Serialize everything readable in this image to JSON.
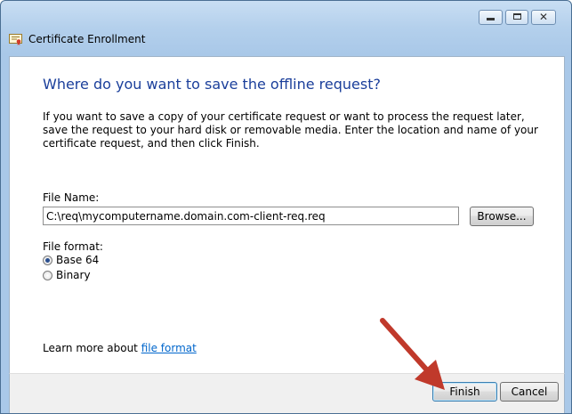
{
  "window": {
    "title": "Certificate Enrollment",
    "controls": {
      "minimize": "minimize",
      "maximize": "maximize",
      "close": "close"
    }
  },
  "page": {
    "heading": "Where do you want to save the offline request?",
    "description": "If you want to save a copy of your certificate request or want to process the request later, save the request to your hard disk or removable media. Enter the location and name of your certificate request, and then click Finish."
  },
  "file_name": {
    "label": "File Name:",
    "value": "C:\\req\\mycomputername.domain.com-client-req.req",
    "browse_label": "Browse..."
  },
  "file_format": {
    "label": "File format:",
    "options": [
      {
        "label": "Base 64",
        "selected": true
      },
      {
        "label": "Binary",
        "selected": false
      }
    ]
  },
  "learn_more": {
    "text": "Learn more about ",
    "link": "file format"
  },
  "footer": {
    "finish_label": "Finish",
    "cancel_label": "Cancel"
  },
  "colors": {
    "heading": "#1b3f9b",
    "link": "#0066cc",
    "annotation_arrow": "#c0392b"
  },
  "icons": [
    "certificate-icon",
    "minimize-icon",
    "maximize-icon",
    "close-icon",
    "radio-selected",
    "radio-unselected",
    "annotation-arrow"
  ]
}
